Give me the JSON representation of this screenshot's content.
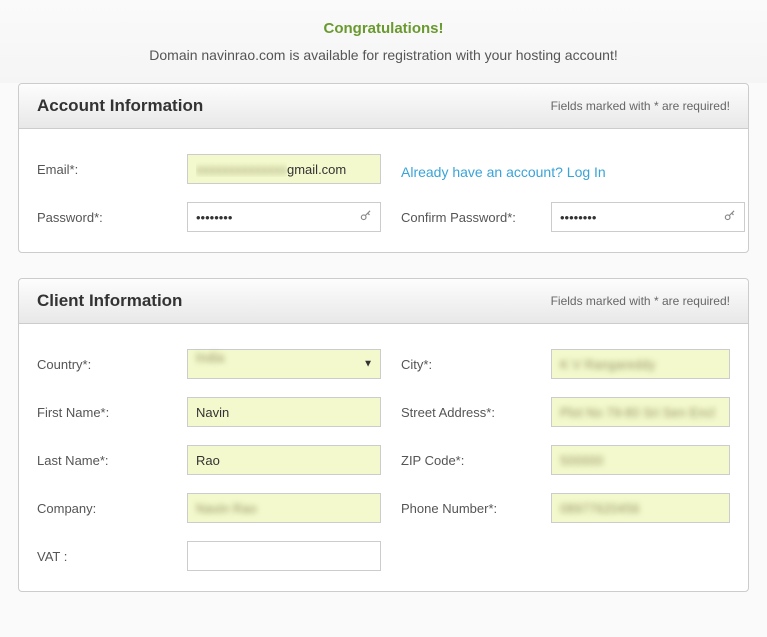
{
  "header": {
    "congrats": "Congratulations!",
    "subtitle": "Domain navinrao.com is available for registration with your hosting account!"
  },
  "account": {
    "title": "Account Information",
    "required_note": "Fields marked with * are required!",
    "email_label": "Email*:",
    "email_blurred": "xxxxxxxxxxxxxx",
    "email_visible": "gmail.com",
    "login_link": "Already have an account? Log In",
    "password_label": "Password*:",
    "password_value": "••••••••",
    "confirm_password_label": "Confirm Password*:",
    "confirm_password_value": "••••••••"
  },
  "client": {
    "title": "Client Information",
    "required_note": "Fields marked with * are required!",
    "country_label": "Country*:",
    "country_value": "India",
    "first_name_label": "First Name*:",
    "first_name_value": "Navin",
    "last_name_label": "Last Name*:",
    "last_name_value": "Rao",
    "company_label": "Company:",
    "company_value": "Navin Rao",
    "vat_label": "VAT :",
    "vat_value": "",
    "city_label": "City*:",
    "city_value": "K V Rangareddy",
    "street_label": "Street Address*:",
    "street_value": "Plot No 79-80 Sri Sen Encl",
    "zip_label": "ZIP Code*:",
    "zip_value": "500000",
    "phone_label": "Phone Number*:",
    "phone_value": "08977620456"
  }
}
